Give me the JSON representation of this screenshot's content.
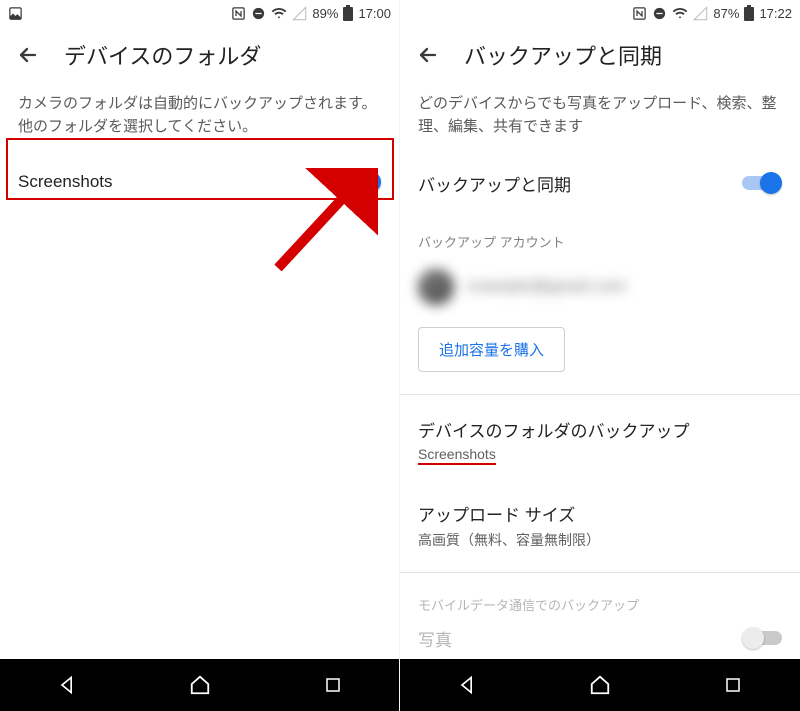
{
  "left": {
    "status": {
      "battery_pct": "89%",
      "time": "17:00"
    },
    "title": "デバイスのフォルダ",
    "description": "カメラのフォルダは自動的にバックアップされます。他のフォルダを選択してください。",
    "folder_row": {
      "label": "Screenshots",
      "enabled": true
    }
  },
  "right": {
    "status": {
      "battery_pct": "87%",
      "time": "17:22"
    },
    "title": "バックアップと同期",
    "description": "どのデバイスからでも写真をアップロード、検索、整理、編集、共有できます",
    "backup_sync": {
      "label": "バックアップと同期",
      "enabled": true
    },
    "account_caption": "バックアップ アカウント",
    "account_email_masked": "example@gmail.com",
    "buy_storage_label": "追加容量を購入",
    "device_folders": {
      "title": "デバイスのフォルダのバックアップ",
      "sub": "Screenshots"
    },
    "upload_size": {
      "title": "アップロード サイズ",
      "sub": "高画質（無料、容量無制限）"
    },
    "mobile_data_caption": "モバイルデータ通信でのバックアップ",
    "photos_row": {
      "label": "写真",
      "enabled": false
    }
  }
}
